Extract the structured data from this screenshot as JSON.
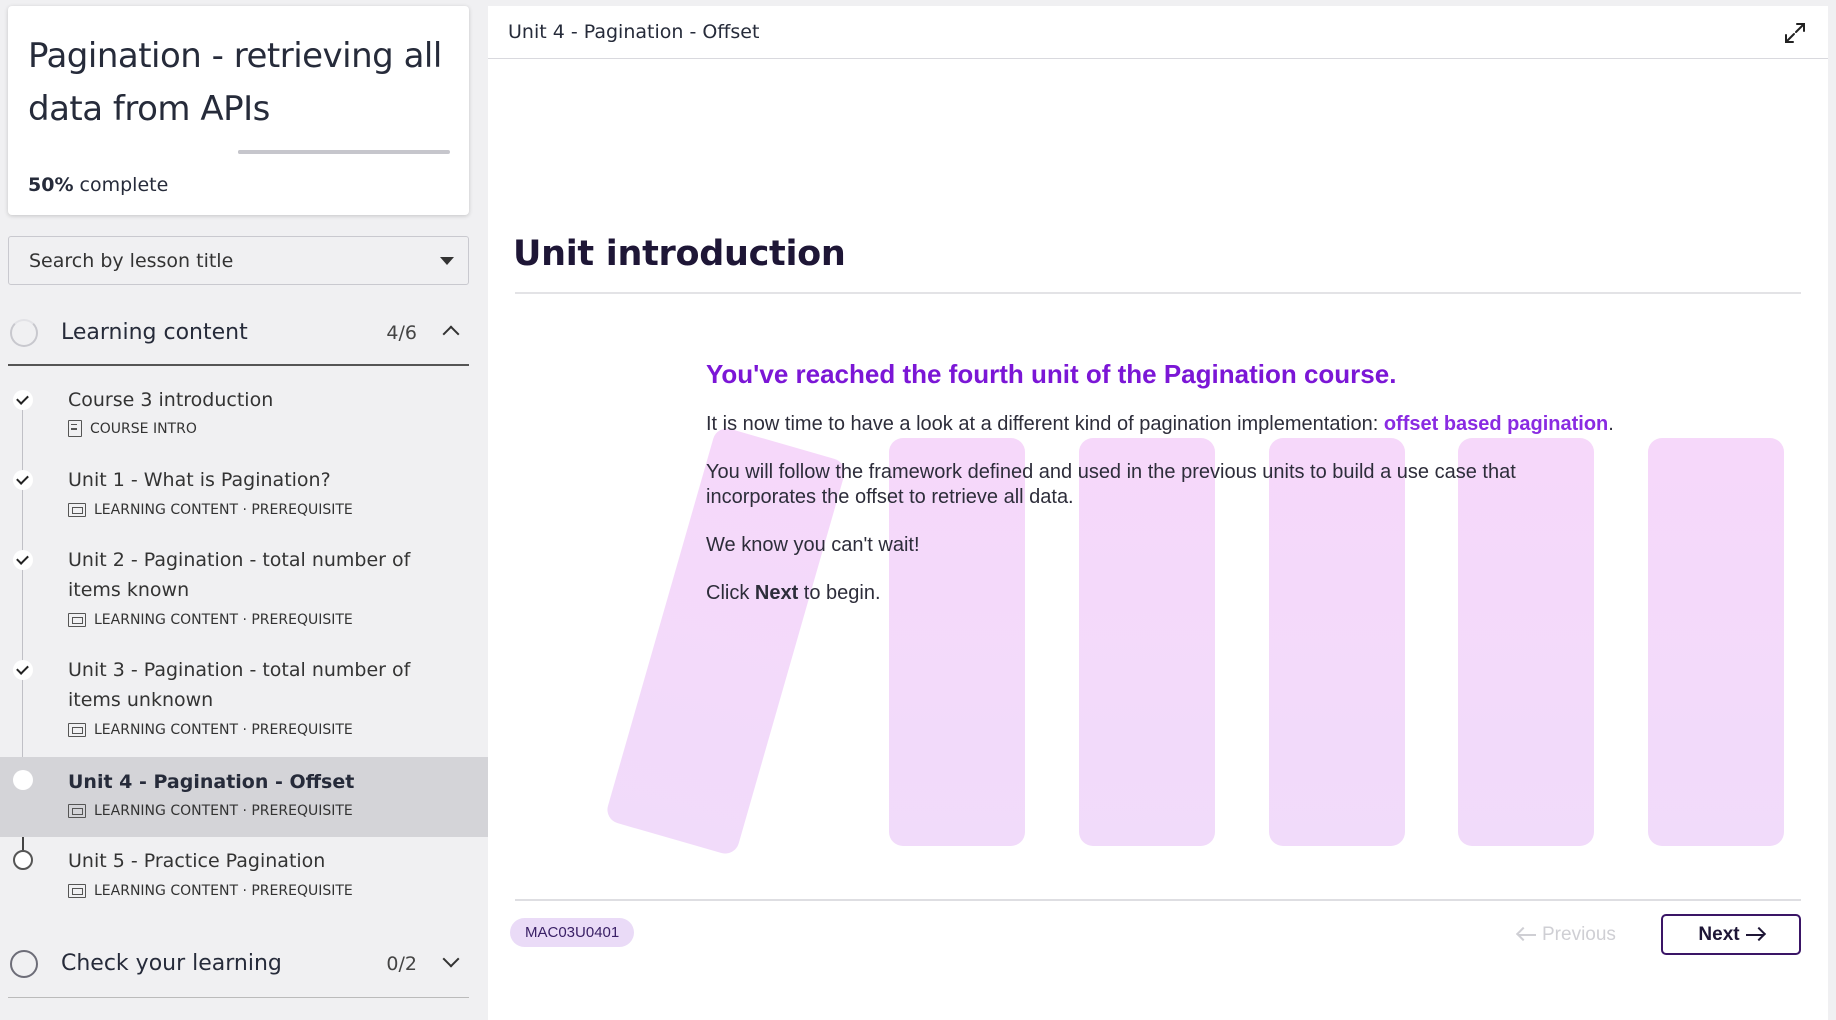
{
  "course": {
    "title": "Pagination - retrieving all data from APIs",
    "progress_percent": "50%",
    "progress_fraction": 0.5,
    "complete_suffix": "complete"
  },
  "search": {
    "placeholder": "Search by lesson title"
  },
  "sections": [
    {
      "label": "Learning content",
      "count": "4/6",
      "expanded": true,
      "lessons": [
        {
          "title": "Course 3 introduction",
          "meta": "COURSE INTRO",
          "status": "done"
        },
        {
          "title": "Unit 1 - What is Pagination?",
          "meta": "LEARNING CONTENT · PREREQUISITE",
          "status": "done"
        },
        {
          "title": "Unit 2 - Pagination - total number of items known",
          "meta": "LEARNING CONTENT · PREREQUISITE",
          "status": "done"
        },
        {
          "title": "Unit 3 - Pagination - total number of items unknown",
          "meta": "LEARNING CONTENT · PREREQUISITE",
          "status": "done"
        },
        {
          "title": "Unit 4 - Pagination - Offset",
          "meta": "LEARNING CONTENT · PREREQUISITE",
          "status": "current"
        },
        {
          "title": "Unit 5 - Practice Pagination",
          "meta": "LEARNING CONTENT · PREREQUISITE",
          "status": "todo"
        }
      ]
    },
    {
      "label": "Check your learning",
      "count": "0/2",
      "expanded": false
    }
  ],
  "main": {
    "breadcrumb": "Unit 4 - Pagination - Offset",
    "heading": "Unit introduction",
    "intro_heading": "You've reached the fourth unit of the Pagination course.",
    "para1_prefix": "It is now time to have a look at a different kind of pagination implementation: ",
    "para1_highlight": "offset based pagination",
    "para1_suffix": ".",
    "para2": "You will follow the framework defined and used in the previous units to build a use case that incorporates the offset to retrieve all data.",
    "para3": "We know you can't wait!",
    "para4_prefix": "Click ",
    "para4_bold": "Next",
    "para4_suffix": " to begin.",
    "code": "MAC03U0401",
    "prev_label": "Previous",
    "next_label": "Next"
  },
  "colors": {
    "accent": "#7b16d6",
    "highlight": "#8a2be2",
    "badge_bg": "#eadbf7",
    "next_border": "#3a1566",
    "decor_bar": "#f3d9fa"
  }
}
